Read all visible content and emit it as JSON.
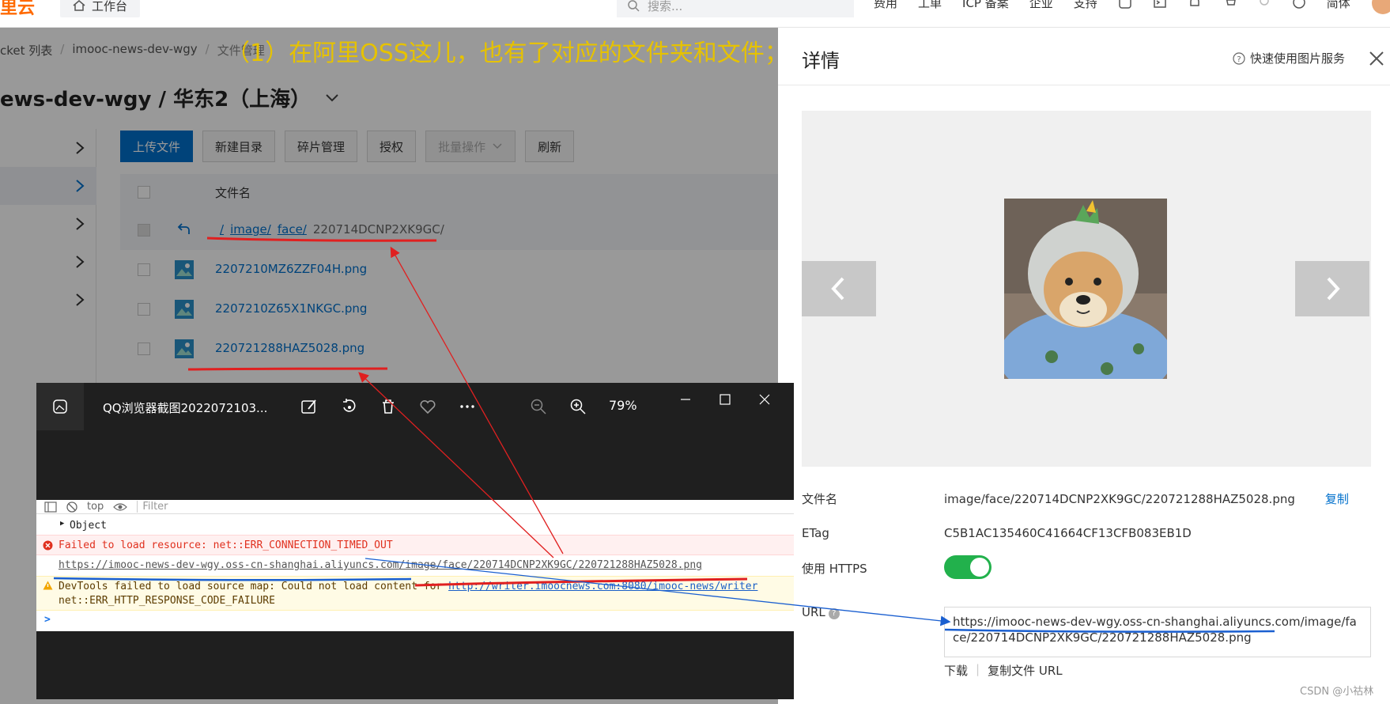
{
  "topbar": {
    "logo": "里云",
    "workbench": "工作台",
    "search_placeholder": "搜索...",
    "nav": [
      "费用",
      "工单",
      "ICP 备案",
      "企业",
      "支持"
    ],
    "lang": "简体"
  },
  "main": {
    "breadcrumb": [
      "cket 列表",
      "imooc-news-dev-wgy",
      "文件管理"
    ],
    "bucket_title": "ews-dev-wgy / 华东2（上海）",
    "toolbar": {
      "upload": "上传文件",
      "new_dir": "新建目录",
      "fragments": "碎片管理",
      "auth": "授权",
      "batch": "批量操作",
      "refresh": "刷新"
    },
    "table_header": "文件名",
    "path": {
      "root": "/",
      "seg1": "image/",
      "seg2": "face/",
      "current": "220714DCNP2XK9GC/"
    },
    "files": [
      "2207210MZ6ZZF04H.png",
      "2207210Z65X1NKGC.png",
      "220721288HAZ5028.png"
    ]
  },
  "annotation": "（1）在阿里OSS这儿，也有了对应的文件夹和文件；",
  "panel": {
    "title": "详情",
    "quick_service": "快速使用图片服务",
    "filename_label": "文件名",
    "filename_value": "image/face/220714DCNP2XK9GC/220721288HAZ5028.png",
    "copy": "复制",
    "etag_label": "ETag",
    "etag_value": "C5B1AC135460C41664CF13CFB083EB1D",
    "https_label": "使用 HTTPS",
    "https_enabled": true,
    "url_label": "URL",
    "url_value": "https://imooc-news-dev-wgy.oss-cn-shanghai.aliyuncs.com/image/face/220714DCNP2XK9GC/220721288HAZ5028.png",
    "download": "下载",
    "copy_url": "复制文件 URL"
  },
  "viewer": {
    "title": "QQ浏览器截图2022072103...",
    "zoom": "79%",
    "console": {
      "context": "top",
      "filter_placeholder": "Filter",
      "object": "Object",
      "error": "Failed to load resource: net::ERR_CONNECTION_TIMED_OUT",
      "error_url": "https://imooc-news-dev-wgy.oss-cn-shanghai.aliyuncs.com/image/face/220714DCNP2XK9GC/220721288HAZ5028.png",
      "warn_text": "DevTools failed to load source map: Could not load content for ",
      "warn_link": "http://writer.imoocnews.com:8080/imooc-news/writer",
      "warn_line2": "net::ERR_HTTP_RESPONSE_CODE_FAILURE",
      "prompt": ">"
    }
  },
  "watermark": "CSDN @小祜林",
  "colors": {
    "accent": "#0070cc",
    "annotation": "#e6c200",
    "red_mark": "#e02020",
    "blue_mark": "#1a5fd0",
    "toggle_on": "#22b14c"
  }
}
